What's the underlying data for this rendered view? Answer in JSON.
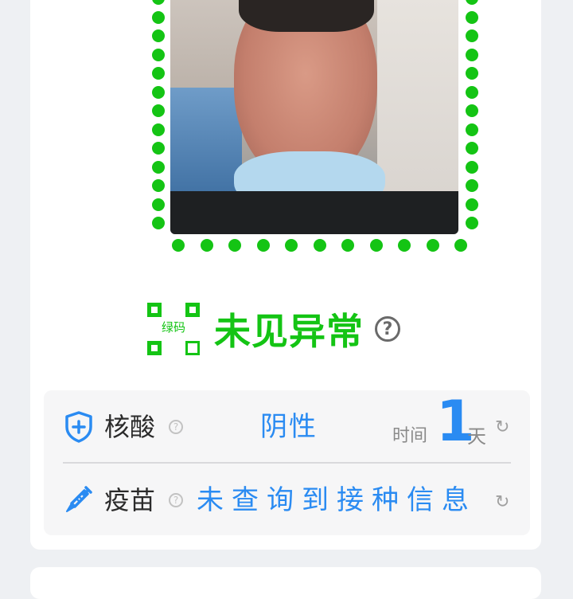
{
  "health_code": {
    "qr_label": "绿码",
    "status": "未见异常",
    "status_color": "#14c414"
  },
  "nucleic_acid": {
    "label": "核酸",
    "result": "阴性",
    "time_label": "时间",
    "days": "1",
    "unit": "天"
  },
  "vaccine": {
    "label": "疫苗",
    "result": "未查询到接种信息"
  },
  "icons": {
    "help": "?",
    "refresh": "↻",
    "shield": "shield-plus-icon",
    "syringe": "syringe-icon"
  },
  "colors": {
    "accent_blue": "#2a8bf2",
    "green": "#14c414"
  }
}
